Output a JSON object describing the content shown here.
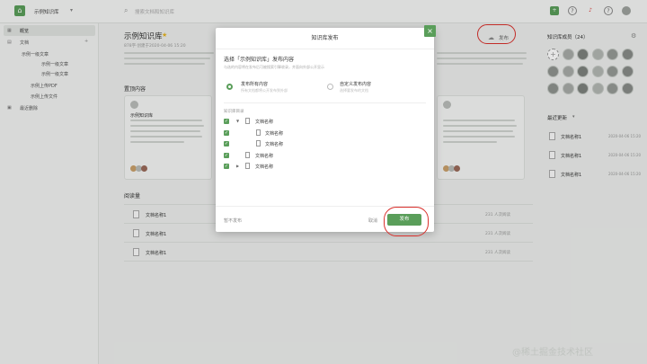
{
  "topbar": {
    "workspace": "示例知识库",
    "search_placeholder": "搜索文档和知识库"
  },
  "sidebar": {
    "overview": "概览",
    "docs": "文档",
    "items": [
      "示例一级文章",
      "示例一级文章",
      "示例一级文章",
      "示例上传PDF",
      "示例上传文件"
    ],
    "trash": "最近删除"
  },
  "main": {
    "title": "示例知识库",
    "meta": "878字·创建于2020-04-06 15:20",
    "featured_title": "置顶内容",
    "card_title": "示例知识库",
    "reading_title": "阅读量",
    "reading_rows": [
      {
        "name": "文档名称1",
        "count": "231 人次阅读"
      },
      {
        "name": "文档名称1",
        "count": "231 人次阅读"
      },
      {
        "name": "文档名称1",
        "count": "231 人次阅读"
      }
    ]
  },
  "right": {
    "members_title": "知识库成员（24）",
    "recent_title": "最近更新",
    "recent": [
      {
        "name": "文档名称1",
        "time": "2020-04-06 15:20"
      },
      {
        "name": "文档名称1",
        "time": "2020-04-06 15:20"
      },
      {
        "name": "文档名称1",
        "time": "2020-04-06 15:20"
      }
    ]
  },
  "publish_label": "发布",
  "modal": {
    "title": "知识库发布",
    "heading": "选择「示例知识库」发布内容",
    "subheading": "与选的内容将在发布后可被搜索引擎收录，并面向外部公开显示",
    "option_all": "发布所有内容",
    "option_all_desc": "所有文档都将公开发布到外部",
    "option_custom": "自定义发布内容",
    "option_custom_desc": "选择要发布的文档",
    "tree_label": "知识库目录",
    "tree": [
      "文档名称",
      "文档名称",
      "文档名称",
      "文档名称",
      "文档名称"
    ],
    "footer_left": "暂不发布",
    "cancel": "取消",
    "publish": "发布"
  },
  "watermark": "@稀土掘金技术社区"
}
